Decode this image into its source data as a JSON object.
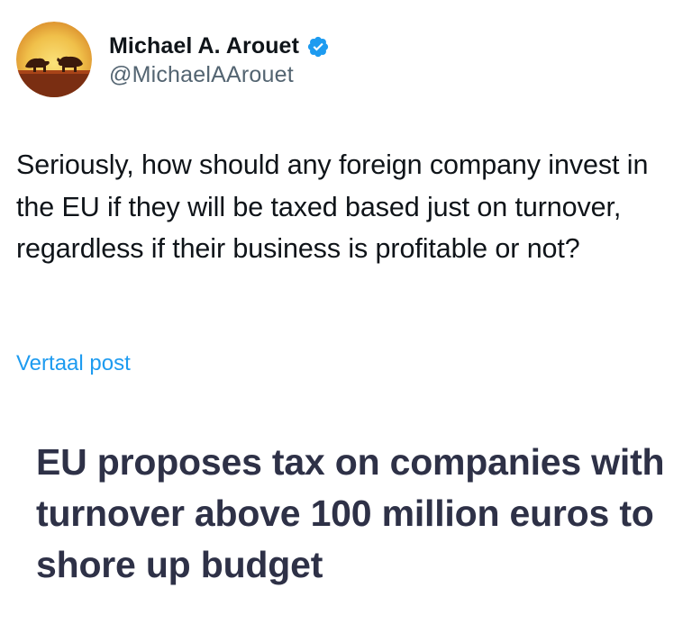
{
  "author": {
    "name": "Michael A. Arouet",
    "handle": "@MichaelAArouet",
    "avatar_icon": "bull-and-bear-sunset-avatar",
    "verified_icon": "verified-badge-icon",
    "verified_color": "#1d9bf0"
  },
  "tweet": {
    "text": "Seriously, how should any foreign company invest in the EU if they will be taxed based just on turnover, regardless if their business is profitable or not?",
    "translate_label": "Vertaal post"
  },
  "card": {
    "headline": "EU proposes tax on companies with turnover above 100 million euros to shore up budget"
  },
  "colors": {
    "text": "#0f1419",
    "secondary": "#536471",
    "link": "#1d9bf0",
    "headline": "#2e3147"
  }
}
